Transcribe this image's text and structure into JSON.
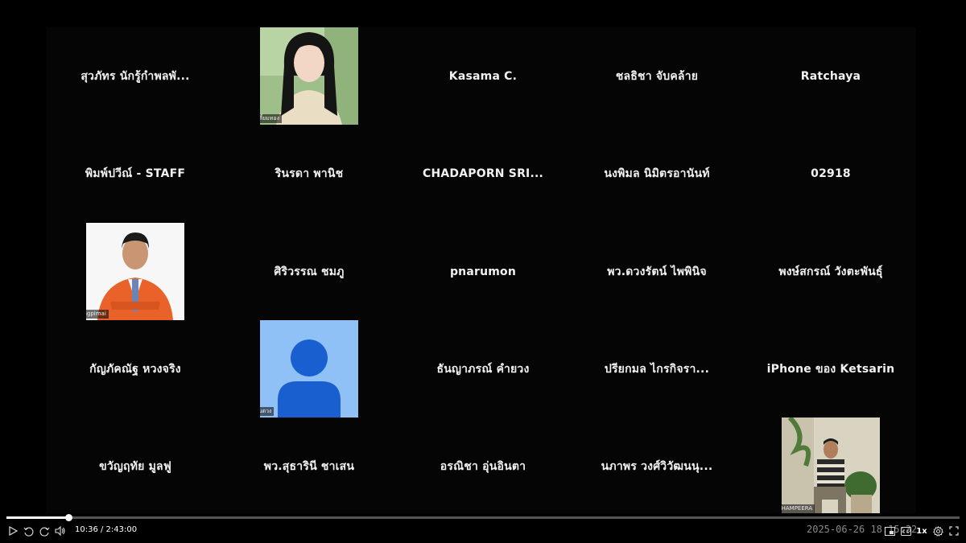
{
  "tiles": [
    {
      "name": "สุวภัทร นักรู้กำพลพั..."
    },
    {
      "name": "Kasama C."
    },
    {
      "name": "ชลธิชา จับคล้าย"
    },
    {
      "name": "Ratchaya"
    },
    {
      "name": "พิมพ์ปวีณ์ - STAFF"
    },
    {
      "name": "รินรดา พานิช"
    },
    {
      "name": "CHADAPORN  SRI..."
    },
    {
      "name": "นงพิมล นิมิตรอานันท์"
    },
    {
      "name": "02918"
    },
    {
      "name": "ศิริวรรณ ชมภู"
    },
    {
      "name": "pnarumon"
    },
    {
      "name": "พว.ดวงรัตน์ ไพพินิจ"
    },
    {
      "name": "พงษ์สกรณ์ วังตะพันธุ์"
    },
    {
      "name": "กัญภัคณัฐ  หวงจริง"
    },
    {
      "name": "ธันญาภรณ์ คำยวง"
    },
    {
      "name": "ปรียกมล ไกรกิจรา..."
    },
    {
      "name": "iPhone ของ Ketsarin"
    },
    {
      "name": "ขวัญฤทัย มูลฟู"
    },
    {
      "name": "พว.สุธารินี ชาเสน"
    },
    {
      "name": "อรณิชา อุ่นอินตา"
    },
    {
      "name": "นภาพร วงศ์วิวัฒนนุ..."
    }
  ],
  "videos": [
    {
      "label": "กัทรดา เฉลิมเลี้ยมทอง"
    },
    {
      "label": "Thiranai Songpimai"
    },
    {
      "label": "ศวพร จันทร์ต้นตวง"
    },
    {
      "label": "WORAPOT KHAMPEERA"
    }
  ],
  "player": {
    "current_time": "10:36",
    "duration": "2:43:00",
    "time_display": "10:36 / 2:43:00",
    "progress_fraction": 0.065,
    "speed": "1x",
    "timestamp": "2025-06-26  18:15:32"
  },
  "icons": [
    "play-icon",
    "rewind-icon",
    "forward-icon",
    "volume-icon",
    "pip-icon",
    "captions-icon",
    "settings-icon",
    "fullscreen-icon"
  ],
  "colors": {
    "background": "#000000",
    "avatar_blue": "#8fc1f6",
    "avatar_dark": "#1a5fd0"
  }
}
